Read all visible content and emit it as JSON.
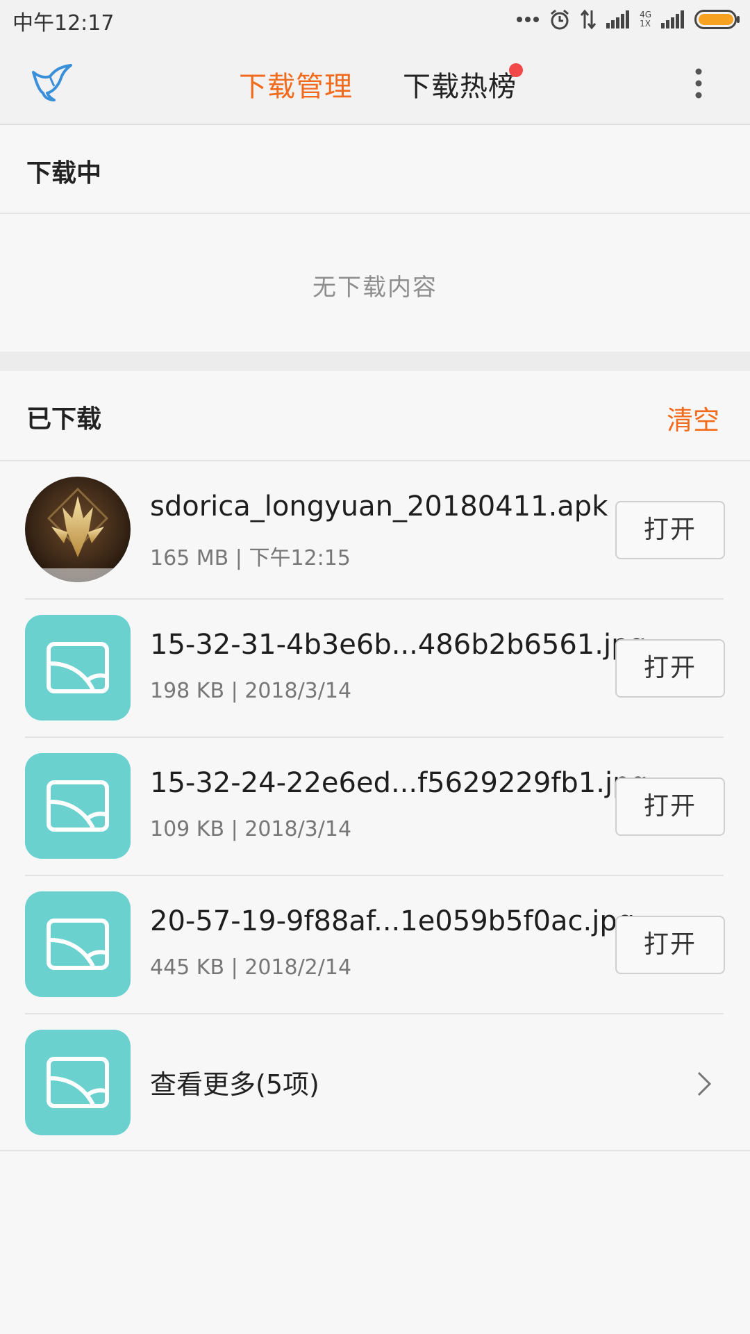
{
  "status": {
    "time": "中午12:17",
    "net_top": "4G",
    "net_bottom": "1X"
  },
  "header": {
    "tab_active": "下载管理",
    "tab_hot": "下载热榜"
  },
  "downloading": {
    "title": "下载中",
    "empty": "无下载内容"
  },
  "downloaded": {
    "title": "已下载",
    "clear": "清空",
    "items": [
      {
        "name": "sdorica_longyuan_20180411.apk",
        "meta": "165 MB | 下午12:15",
        "open": "打开",
        "icon": "game-app-icon"
      },
      {
        "name": "15-32-31-4b3e6b...486b2b6561.jpg",
        "meta": "198 KB | 2018/3/14",
        "open": "打开",
        "icon": "image-file-icon"
      },
      {
        "name": "15-32-24-22e6ed...f5629229fb1.jpg",
        "meta": "109 KB | 2018/3/14",
        "open": "打开",
        "icon": "image-file-icon"
      },
      {
        "name": "20-57-19-9f88af...1e059b5f0ac.jpg",
        "meta": "445 KB | 2018/2/14",
        "open": "打开",
        "icon": "image-file-icon"
      }
    ],
    "more": "查看更多(5项)"
  },
  "colors": {
    "accent": "#f26b1d",
    "thumb": "#6bd1cf",
    "badge": "#f2484a",
    "battery": "#f7a120"
  }
}
